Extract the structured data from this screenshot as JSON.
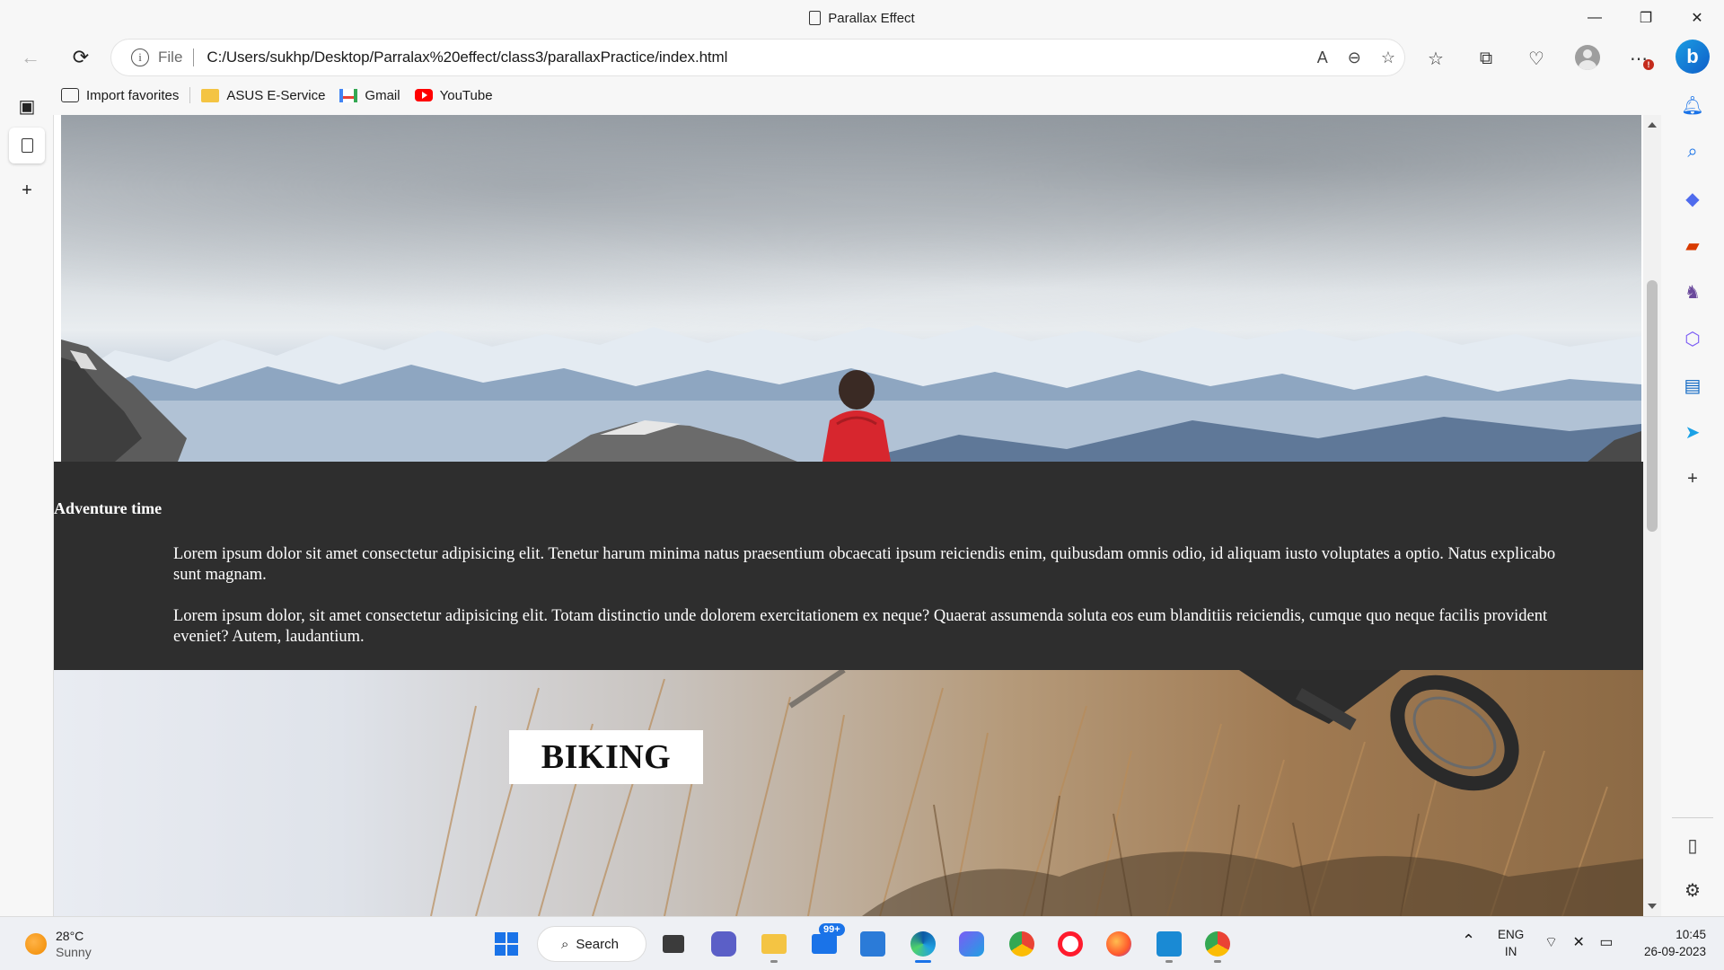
{
  "window": {
    "title": "Parallax Effect",
    "controls": {
      "minimize": "—",
      "restore": "❐",
      "close": "✕"
    }
  },
  "nav": {
    "back_icon": "←",
    "refresh_icon": "⟳",
    "info_icon": "i",
    "file_label": "File",
    "url": "C:/Users/sukhp/Desktop/Parralax%20effect/class3/parallaxPractice/index.html"
  },
  "favorites": [
    {
      "label": "Import favorites",
      "icon": "import-icon"
    },
    {
      "label": "ASUS E-Service",
      "icon": "folder-icon"
    },
    {
      "label": "Gmail",
      "icon": "gmail-icon"
    },
    {
      "label": "YouTube",
      "icon": "youtube-icon"
    }
  ],
  "toolbar": {
    "notification_count": "!"
  },
  "page": {
    "adventure_heading": "Adventure time",
    "paragraph_1": "Lorem ipsum dolor sit amet consectetur adipisicing elit. Tenetur harum minima natus praesentium obcaecati ipsum reiciendis enim, quibusdam omnis odio, id aliquam iusto voluptates a optio. Natus explicabo sunt magnam.",
    "paragraph_2": "Lorem ipsum dolor, sit amet consectetur adipisicing elit. Totam distinctio unde dolorem exercitationem ex neque? Quaerat assumenda soluta eos eum blanditiis reiciendis, cumque quo neque facilis provident eveniet? Autem, laudantium.",
    "biking_title": "BIKING",
    "colors": {
      "dark_band": "#2e2e2e",
      "jacket_red": "#d7262e"
    }
  },
  "taskbar": {
    "weather": {
      "temp": "28°C",
      "condition": "Sunny"
    },
    "search_label": "Search",
    "mail_badge": "99+",
    "language": {
      "line1": "ENG",
      "line2": "IN"
    },
    "clock": {
      "time": "10:45",
      "date": "26-09-2023"
    }
  }
}
